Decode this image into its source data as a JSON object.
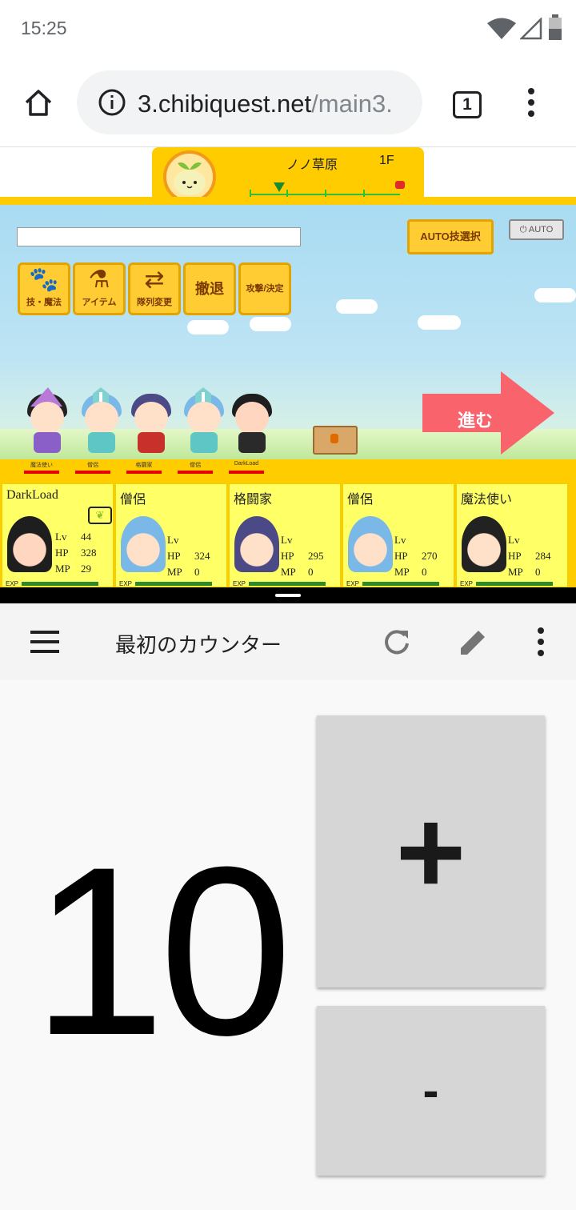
{
  "status_bar": {
    "time": "15:25"
  },
  "browser": {
    "url_host": "3.chibiquest.net",
    "url_path": "/main3.",
    "tab_count": "1"
  },
  "game": {
    "area_name": "ノノ草原",
    "floor": "1F",
    "auto_select_label": "AUTO技選択",
    "auto_toggle_label": "AUTO",
    "commands": [
      {
        "label": "技・魔法",
        "icon": "paw-icon"
      },
      {
        "label": "アイテム",
        "icon": "potion-icon"
      },
      {
        "label": "隊列変更",
        "icon": "swap-arrows-icon"
      },
      {
        "label": "撤退",
        "icon": ""
      },
      {
        "label": "攻撃/決定",
        "icon": ""
      }
    ],
    "advance_label": "進む",
    "party_order": [
      "魔法使い",
      "僧侶",
      "格闘家",
      "僧侶",
      "DarkLoad"
    ],
    "cards": [
      {
        "name": "DarkLoad",
        "lv_label": "Lv",
        "lv": "44",
        "hp_label": "HP",
        "hp": "328",
        "mp_label": "MP",
        "mp": "29",
        "exp_label": "EXP"
      },
      {
        "name": "僧侶",
        "lv_label": "Lv",
        "lv": "",
        "hp_label": "HP",
        "hp": "324",
        "mp_label": "MP",
        "mp": "0",
        "exp_label": "EXP"
      },
      {
        "name": "格闘家",
        "lv_label": "Lv",
        "lv": "",
        "hp_label": "HP",
        "hp": "295",
        "mp_label": "MP",
        "mp": "0",
        "exp_label": "EXP"
      },
      {
        "name": "僧侶",
        "lv_label": "Lv",
        "lv": "",
        "hp_label": "HP",
        "hp": "270",
        "mp_label": "MP",
        "mp": "0",
        "exp_label": "EXP"
      },
      {
        "name": "魔法使い",
        "lv_label": "Lv",
        "lv": "",
        "hp_label": "HP",
        "hp": "284",
        "mp_label": "MP",
        "mp": "0",
        "exp_label": "EXP"
      }
    ],
    "colors": {
      "accent": "#ffcc00",
      "card": "#ffff66",
      "advance": "#f9646c"
    }
  },
  "counter_app": {
    "title": "最初のカウンター",
    "count": "10",
    "plus_label": "+",
    "minus_label": "-"
  }
}
